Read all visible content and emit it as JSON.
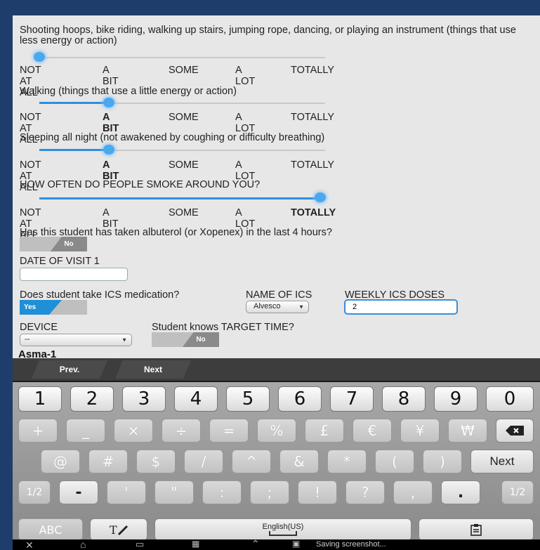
{
  "survey": {
    "q1": {
      "text": "Shooting hoops, bike riding, walking up stairs, jumping rope, dancing, or playing an instrument (things that use less energy or action)",
      "selected": 0
    },
    "q2": {
      "text": "Walking (things that use a little energy or action)",
      "selected": 1
    },
    "q3": {
      "text": "Sleeping all night (not awakened by coughing or difficulty breathing)",
      "selected": 1
    },
    "q4": {
      "text": "HOW OFTEN DO PEOPLE SMOKE AROUND YOU?",
      "selected": 4
    },
    "options": [
      "NOT AT ALL",
      "A BIT",
      "SOME",
      "A LOT",
      "TOTALLY"
    ]
  },
  "form": {
    "albuterol_label": "Has this student has taken albuterol (or Xopenex) in the last 4 hours?",
    "albuterol_toggle": "No",
    "date_label": "DATE OF VISIT 1",
    "date_value": "",
    "ics_label": "Does student take ICS medication?",
    "ics_toggle": "Yes",
    "ics_name_label": "NAME OF ICS",
    "ics_name_value": "Alvesco",
    "weekly_label": "WEEKLY ICS DOSES",
    "weekly_value": "2",
    "device_label": "DEVICE",
    "device_value": "--",
    "target_label": "Student knows TARGET TIME?",
    "target_toggle": "No",
    "section_title": "Asma-1"
  },
  "keyboard": {
    "prev_label": "Prev.",
    "next_label": "Next",
    "row1": [
      "1",
      "2",
      "3",
      "4",
      "5",
      "6",
      "7",
      "8",
      "9",
      "0"
    ],
    "row2": [
      "+",
      "_",
      "×",
      "÷",
      "=",
      "%",
      "£",
      "€",
      "¥",
      "₩"
    ],
    "row3": [
      "@",
      "#",
      "$",
      "/",
      "^",
      "&",
      "*",
      "(",
      ")"
    ],
    "row3_action": "Next",
    "row4": [
      "1/2",
      "-",
      "'",
      "\"",
      ":",
      ";",
      "!",
      "?",
      ",",
      ".",
      "1/2"
    ],
    "abc_label": "ABC",
    "space_label": "English(US)"
  },
  "status": {
    "saving": "Saving screenshot..."
  },
  "colors": {
    "accent": "#2d8fe0",
    "toggle_yes": "#1f8fd6",
    "toggle_off": "#888888"
  }
}
